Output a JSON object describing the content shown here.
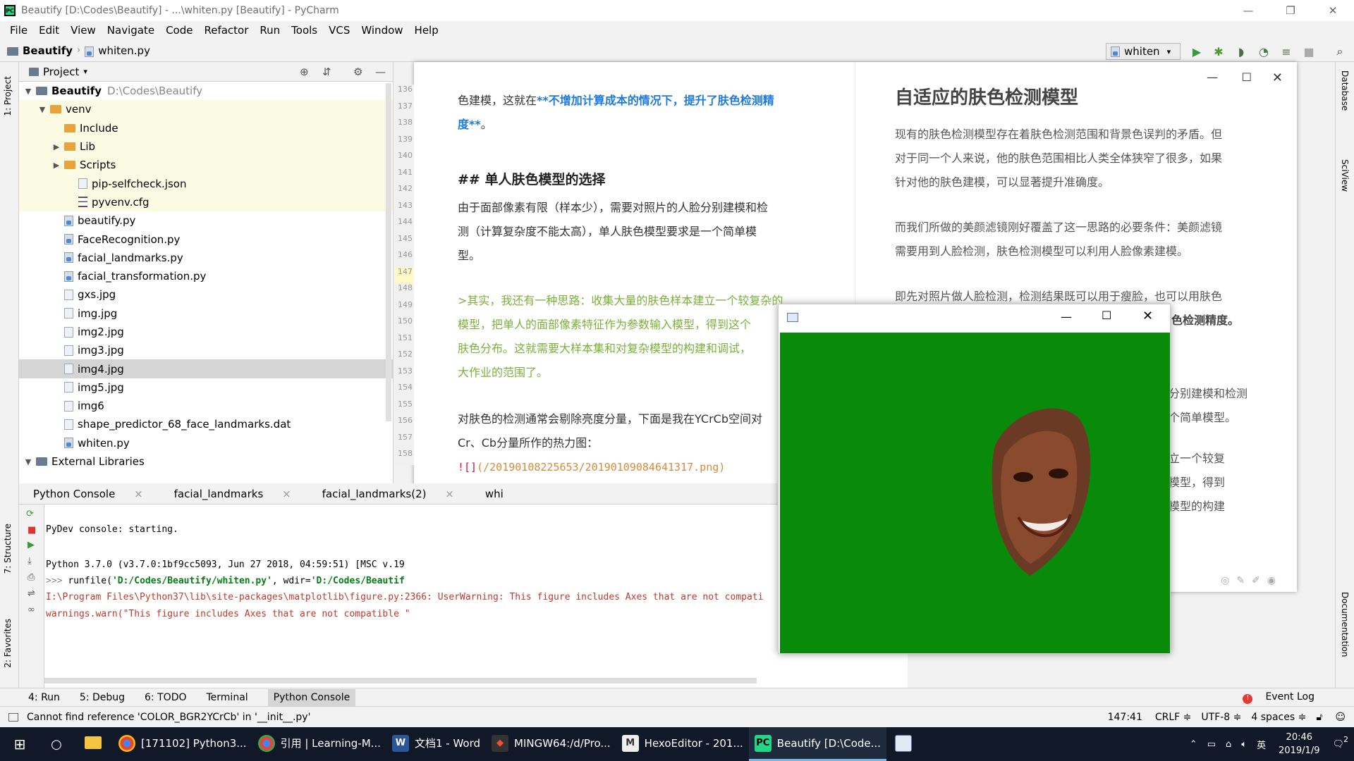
{
  "window": {
    "title": "Beautify [D:\\Codes\\Beautify] - ...\\whiten.py [Beautify] - PyCharm",
    "min": "—",
    "restore": "❐",
    "close": "✕"
  },
  "menu": [
    "File",
    "Edit",
    "View",
    "Navigate",
    "Code",
    "Refactor",
    "Run",
    "Tools",
    "VCS",
    "Window",
    "Help"
  ],
  "breadcrumb": {
    "project": "Beautify",
    "file": "whiten.py"
  },
  "run_config": "whiten",
  "project_panel": {
    "title": "Project",
    "tree": [
      {
        "label": "Beautify",
        "path": "D:\\Codes\\Beautify",
        "indent": 0,
        "arrow": "▼",
        "icon": "folder",
        "bold": true
      },
      {
        "label": "venv",
        "indent": 1,
        "arrow": "▼",
        "icon": "folder-y",
        "hl": true
      },
      {
        "label": "Include",
        "indent": 2,
        "arrow": "",
        "icon": "folder-y",
        "hl": true
      },
      {
        "label": "Lib",
        "indent": 2,
        "arrow": "▶",
        "icon": "folder-y",
        "hl": true
      },
      {
        "label": "Scripts",
        "indent": 2,
        "arrow": "▶",
        "icon": "folder-y",
        "hl": true
      },
      {
        "label": "pip-selfcheck.json",
        "indent": 3,
        "arrow": "",
        "icon": "file",
        "hl": true
      },
      {
        "label": "pyvenv.cfg",
        "indent": 3,
        "arrow": "",
        "icon": "cfg",
        "hl": true
      },
      {
        "label": "beautify.py",
        "indent": 2,
        "arrow": "",
        "icon": "py"
      },
      {
        "label": "FaceRecognition.py",
        "indent": 2,
        "arrow": "",
        "icon": "py"
      },
      {
        "label": "facial_landmarks.py",
        "indent": 2,
        "arrow": "",
        "icon": "py"
      },
      {
        "label": "facial_transformation.py",
        "indent": 2,
        "arrow": "",
        "icon": "py"
      },
      {
        "label": "gxs.jpg",
        "indent": 2,
        "arrow": "",
        "icon": "img"
      },
      {
        "label": "img.jpg",
        "indent": 2,
        "arrow": "",
        "icon": "img"
      },
      {
        "label": "img2.jpg",
        "indent": 2,
        "arrow": "",
        "icon": "img"
      },
      {
        "label": "img3.jpg",
        "indent": 2,
        "arrow": "",
        "icon": "img"
      },
      {
        "label": "img4.jpg",
        "indent": 2,
        "arrow": "",
        "icon": "img",
        "sel": true
      },
      {
        "label": "img5.jpg",
        "indent": 2,
        "arrow": "",
        "icon": "img"
      },
      {
        "label": "img6",
        "indent": 2,
        "arrow": "",
        "icon": "img"
      },
      {
        "label": "shape_predictor_68_face_landmarks.dat",
        "indent": 2,
        "arrow": "",
        "icon": "file"
      },
      {
        "label": "whiten.py",
        "indent": 2,
        "arrow": "",
        "icon": "py"
      },
      {
        "label": "External Libraries",
        "indent": 0,
        "arrow": "▼",
        "icon": "lib"
      }
    ]
  },
  "gutter": [
    "136",
    "137",
    "138",
    "139",
    "140",
    "141",
    "142",
    "143",
    "144",
    "145",
    "146",
    "147",
    "148",
    "149",
    "150",
    "151",
    "152",
    "153",
    "154",
    "155",
    "156",
    "157",
    "158"
  ],
  "markdown_src": {
    "l1": "色建模，这就在",
    "l1_bold": "**不增加计算成本的情况下，提升了肤色检测精",
    "l2_bold": "度**",
    "l2_tail": "。",
    "heading": "##  单人肤色模型的选择",
    "p1": "由于面部像素有限（样本少），需要对照片的人脸分别建模和检",
    "p2": "测（计算复杂度不能太高），单人肤色模型要求是一个简单模",
    "p3": "型。",
    "q1": ">其实，我还有一种思路：收集大量的肤色样本建立一个较复杂的",
    "q2": "模型，把单人的面部像素特征作为参数输入模型，得到这个",
    "q3": "肤色分布。这就需要大样本集和对复杂模型的构建和调试，",
    "q4": "大作业的范围了。",
    "p4": "对肤色的检测通常会剔除亮度分量，下面是我在YCrCb空间对",
    "p5": "Cr、Cb分量所作的热力图：",
    "img_prefix": "![]",
    "img_link": "(/20190108225653/20190109084641317.png)"
  },
  "preview": {
    "title": "自适应的肤色检测模型",
    "p1": "现有的肤色检测模型存在着肤色检测范围和背景色误判的矛盾。但",
    "p2": "对于同一个人来说，他的肤色范围相比人类全体狭窄了很多，如果",
    "p3": "针对他的肤色建模，可以显著提升准确度。",
    "p4": "而我们所做的美颜滤镜刚好覆盖了这一思路的必要条件：美颜滤镜",
    "p5": "需要用到人脸检测，肤色检测模型可以利用人脸像素建模。",
    "p6": "即先对照片做人脸检测，检测结果既可以用于瘦脸，也可以用肤色",
    "p7": "色检测精度。",
    "p8": "分别建模和检测",
    "p9": "个简单模型。",
    "p10": "立一个较复",
    "p11": "模型，得到",
    "p12": "模型的构建"
  },
  "console_tabs": [
    "Python Console",
    "facial_landmarks",
    "facial_landmarks(2)",
    "whi"
  ],
  "console": {
    "l1": "PyDev console: starting.",
    "l2": "Python 3.7.0 (v3.7.0:1bf9cc5093, Jun 27 2018, 04:59:51) [MSC v.19",
    "l3_prompt": ">>> ",
    "l3_a": "runfile(",
    "l3_b": "'D:/Codes/Beautify/whiten.py'",
    "l3_c": ", wdir=",
    "l3_d": "'D:/Codes/Beautif",
    "l4": "I:\\Program Files\\Python37\\lib\\site-packages\\matplotlib\\figure.py:2366: UserWarning: This figure includes Axes that are not compati",
    "l5": "  warnings.warn(\"This figure includes Axes that are not compatible \""
  },
  "bottom_tabs": [
    "4: Run",
    "5: Debug",
    "6: TODO",
    "Terminal",
    "Python Console"
  ],
  "event_log": "Event Log",
  "status": {
    "msg": "Cannot find reference 'COLOR_BGR2YCrCb' in '__init__.py'",
    "pos": "147:41",
    "crlf": "CRLF ≑",
    "enc": "UTF-8 ≑",
    "indent": "4 spaces ≑"
  },
  "right_stripe": [
    "Database",
    "SciView",
    "Documentation"
  ],
  "left_stripe": [
    "1: Project",
    "7: Structure",
    "2: Favorites"
  ],
  "taskbar": {
    "items": [
      "[171102] Python3...",
      "引用 | Learning-M...",
      "文档1 - Word",
      "MINGW64:/d/Pro...",
      "HexoEditor - 201...",
      "Beautify [D:\\Code..."
    ],
    "time": "20:46",
    "date": "2019/1/9",
    "ime": "英",
    "notif": "2"
  }
}
